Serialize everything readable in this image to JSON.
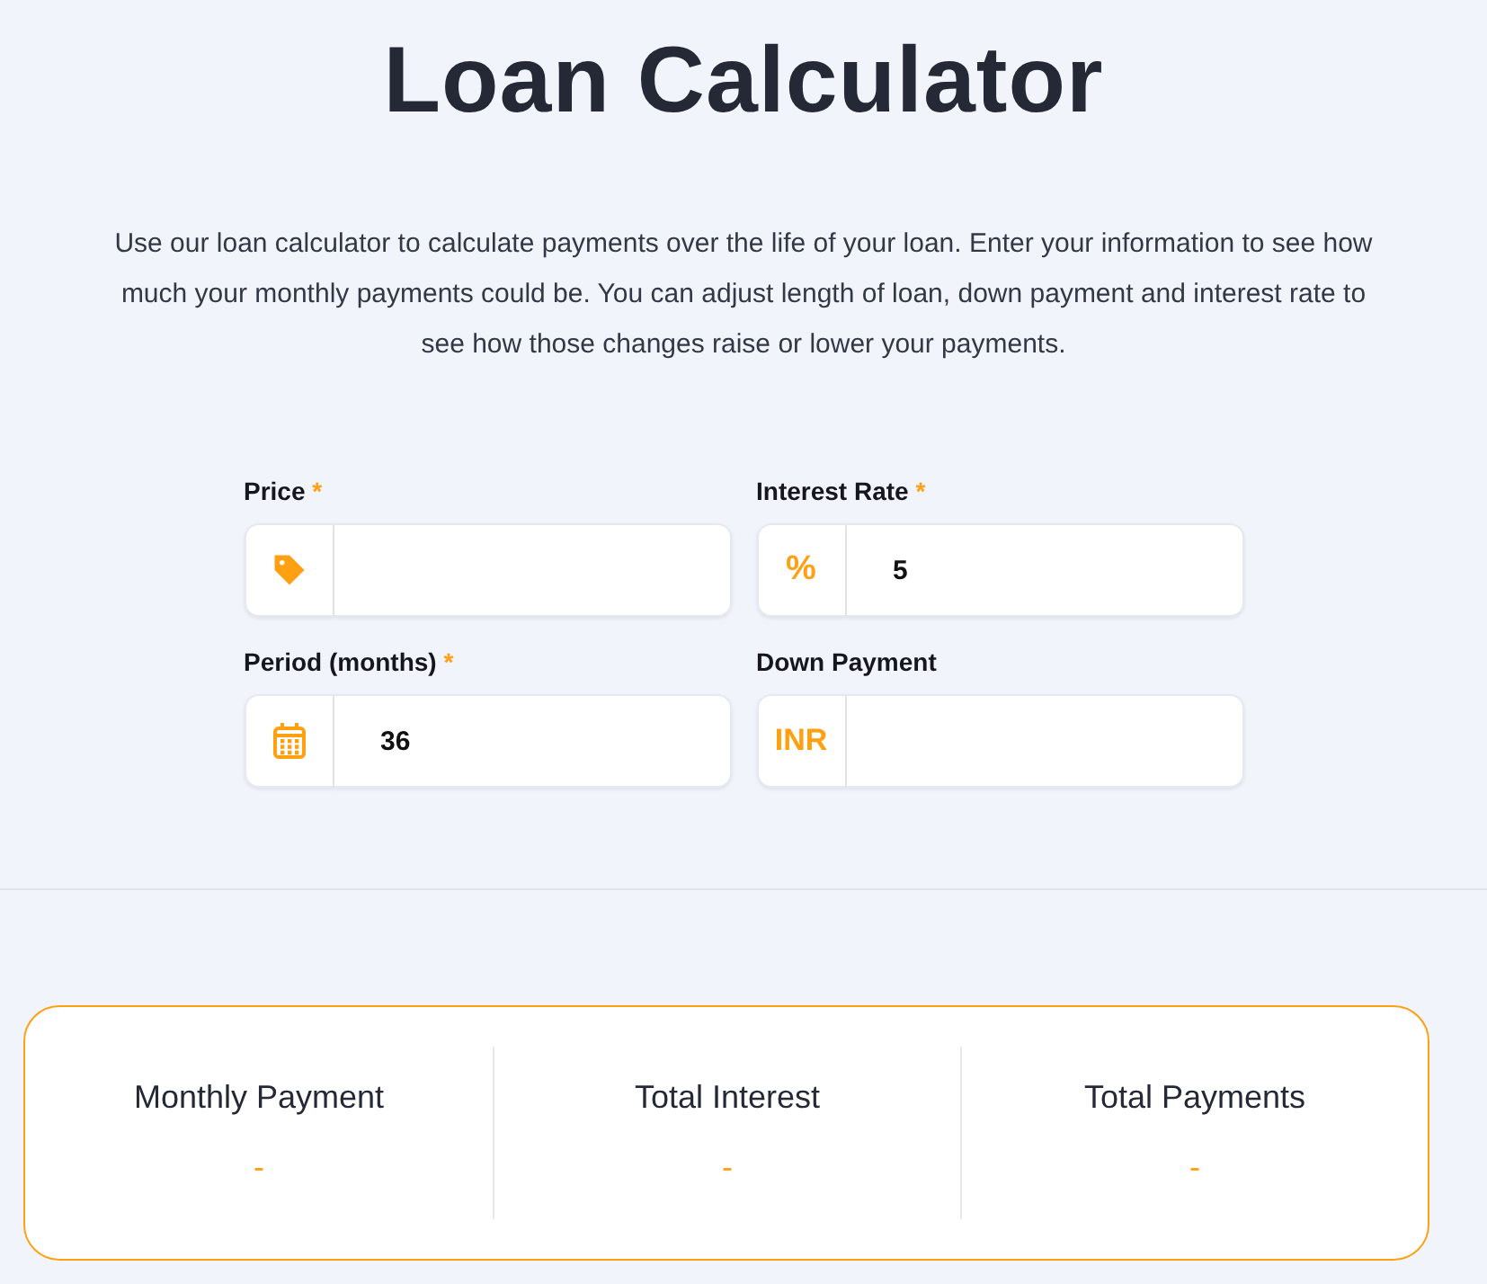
{
  "title": "Loan Calculator",
  "intro": "Use our loan calculator to calculate payments over the life of your loan. Enter your information to see how much your monthly payments could be. You can adjust length of loan, down payment and interest rate to see how those changes raise or lower your payments.",
  "required_mark": "*",
  "fields": [
    {
      "label": "Price",
      "required": true,
      "prefix": {
        "kind": "tag-icon"
      }
    },
    {
      "label": "Interest Rate",
      "required": true,
      "prefix": {
        "kind": "text",
        "text": "%"
      },
      "value": "5"
    },
    {
      "label": "Period (months)",
      "required": true,
      "prefix": {
        "kind": "calendar-icon"
      },
      "value": "36"
    },
    {
      "label": "Down Payment",
      "required": false,
      "prefix": {
        "kind": "text",
        "text": "INR"
      }
    }
  ],
  "results": [
    {
      "label": "Monthly Payment",
      "value": "-"
    },
    {
      "label": "Total Interest",
      "value": "-"
    },
    {
      "label": "Total Payments",
      "value": "-"
    }
  ]
}
